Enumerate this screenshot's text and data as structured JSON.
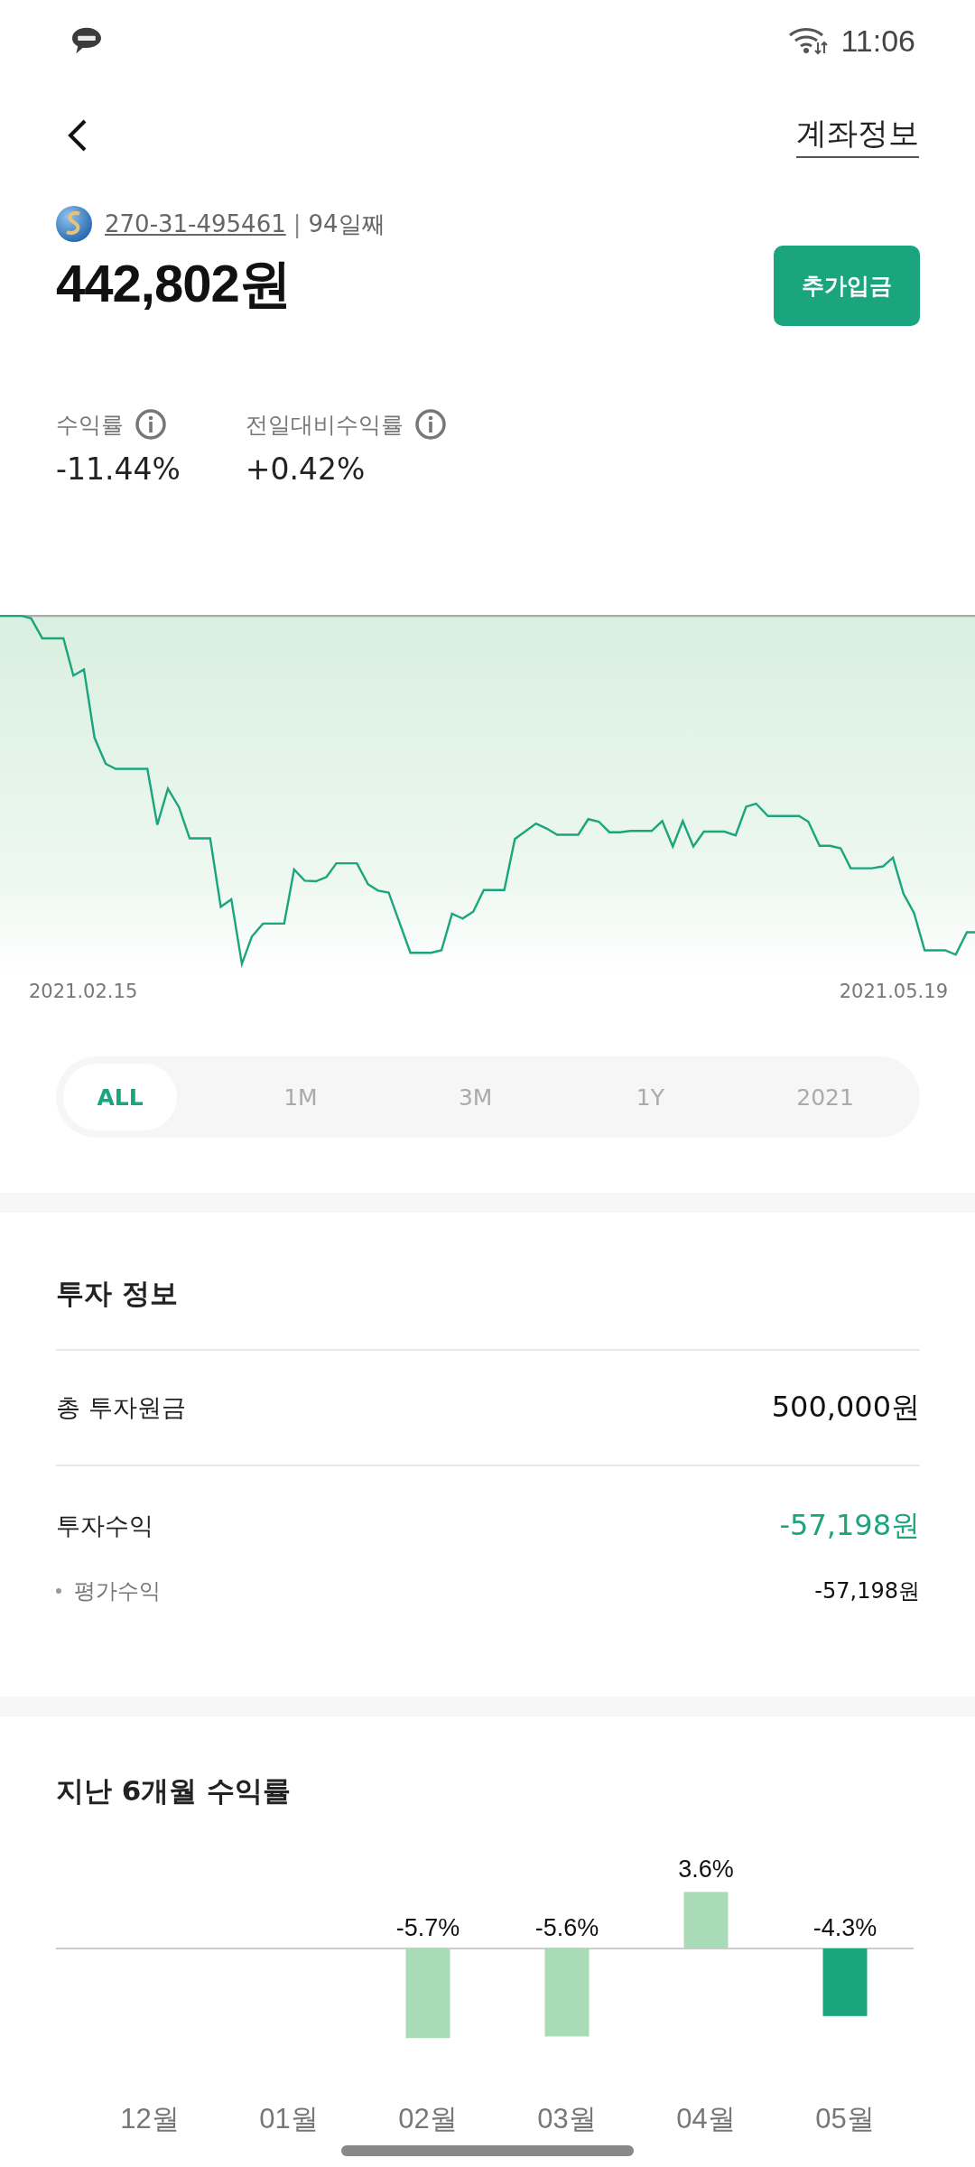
{
  "status_bar": {
    "time": "11:06"
  },
  "header": {
    "account_info_link": "계좌정보"
  },
  "account": {
    "number": "270-31-495461",
    "separator": "|",
    "days": "94일째",
    "balance": "442,802원",
    "deposit_button": "추가입금"
  },
  "metrics": [
    {
      "label": "수익률",
      "value": "-11.44%"
    },
    {
      "label": "전일대비수익률",
      "value": "+0.42%"
    }
  ],
  "performance_chart": {
    "start_date": "2021.02.15",
    "end_date": "2021.05.19"
  },
  "period_tabs": [
    {
      "label": "ALL",
      "selected": true
    },
    {
      "label": "1M",
      "selected": false
    },
    {
      "label": "3M",
      "selected": false
    },
    {
      "label": "1Y",
      "selected": false
    },
    {
      "label": "2021",
      "selected": false
    }
  ],
  "investment_info": {
    "title": "투자 정보",
    "rows": [
      {
        "label": "총 투자원금",
        "value": "500,000원",
        "kind": "total"
      },
      {
        "label": "투자수익",
        "value": "-57,198원",
        "kind": "profit"
      },
      {
        "label": "평가수익",
        "value": "-57,198원",
        "kind": "sub"
      }
    ]
  },
  "monthly_returns": {
    "title": "지난 6개월 수익률",
    "chart_data": {
      "type": "bar",
      "categories": [
        "12월",
        "01월",
        "02월",
        "03월",
        "04월",
        "05월"
      ],
      "series": [
        {
          "color": "#a9dcb6",
          "values": [
            null,
            null,
            -5.7,
            -5.6,
            3.6,
            null
          ],
          "value_labels": [
            null,
            null,
            "-5.7%",
            "-5.6%",
            "3.6%",
            null
          ]
        },
        {
          "color": "#1aa57e",
          "values": [
            null,
            null,
            null,
            null,
            null,
            -4.3
          ],
          "value_labels": [
            null,
            null,
            null,
            null,
            null,
            "-4.3%"
          ]
        }
      ]
    }
  }
}
